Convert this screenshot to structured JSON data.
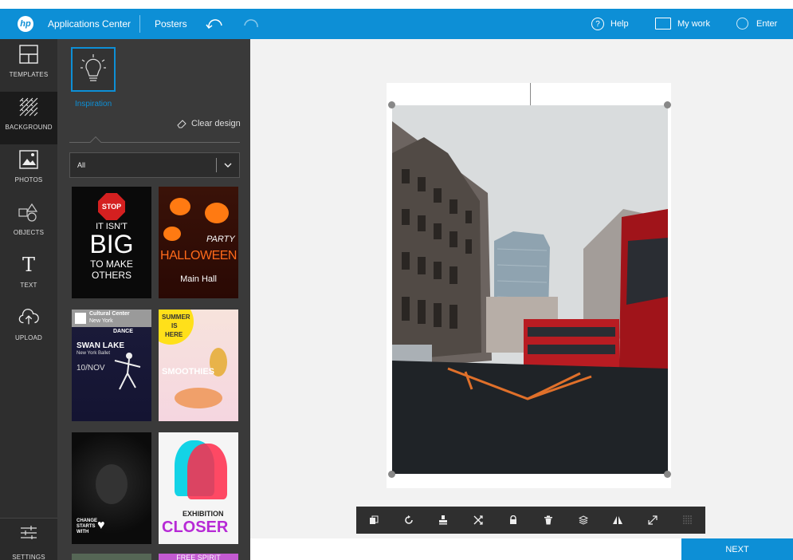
{
  "header": {
    "logo_text": "hp",
    "app_title": "Applications Center",
    "section": "Posters",
    "help_label": "Help",
    "mywork_label": "My work",
    "enter_label": "Enter"
  },
  "rail": {
    "items": [
      {
        "label": "TEMPLATES",
        "icon": "templates-icon"
      },
      {
        "label": "BACKGROUND",
        "icon": "background-icon"
      },
      {
        "label": "PHOTOS",
        "icon": "photos-icon"
      },
      {
        "label": "OBJECTS",
        "icon": "objects-icon"
      },
      {
        "label": "TEXT",
        "icon": "text-icon"
      },
      {
        "label": "UPLOAD",
        "icon": "upload-icon"
      }
    ],
    "settings_label": "SETTINGS"
  },
  "panel": {
    "inspiration_label": "Inspiration",
    "clear_design_label": "Clear design",
    "filter_value": "All",
    "templates": {
      "t1": {
        "lines": [
          "STOP",
          "IT ISN'T",
          "BIG",
          "TO MAKE",
          "OTHERS"
        ]
      },
      "t2": {
        "lines": [
          "PARTY",
          "HALLOWEEN",
          "Main Hall"
        ]
      },
      "t3": {
        "lines": [
          "Cultural Center",
          "New York",
          "DANCE",
          "SWAN LAKE",
          "New York Ballet",
          "10/NOV"
        ]
      },
      "t4": {
        "lines": [
          "SUMMER",
          "IS",
          "HERE",
          "SMOOTHIES"
        ]
      },
      "t5": {
        "lines": [
          "CHANGE",
          "STARTS",
          "WITH"
        ]
      },
      "t6": {
        "lines": [
          "EXHIBITION",
          "CLOSER"
        ]
      },
      "t8": {
        "lines": [
          "FREE SPIRIT"
        ]
      }
    }
  },
  "toolbar": {
    "tools": [
      "duplicate-icon",
      "rotate-icon",
      "stamp-icon",
      "shuffle-icon",
      "lock-icon",
      "trash-icon",
      "layers-icon",
      "flip-icon",
      "resize-icon",
      "grid-icon"
    ]
  },
  "footer": {
    "next_label": "NEXT"
  },
  "colors": {
    "accent": "#0d8fd6",
    "rail_bg": "#2e2e2e",
    "panel_bg": "#3a3a3a",
    "canvas_bg": "#f2f2f2"
  }
}
